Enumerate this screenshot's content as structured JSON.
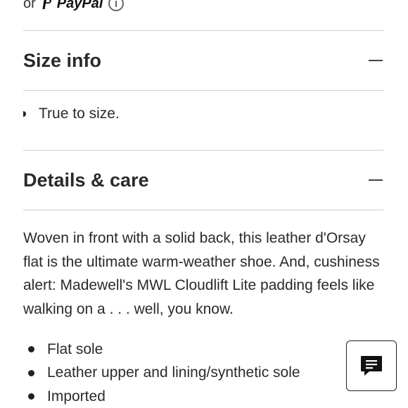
{
  "payment": {
    "or_text": "or",
    "paypal_text": "PayPal"
  },
  "sections": {
    "size_info": {
      "title": "Size info",
      "bullet": "True to size."
    },
    "details_care": {
      "title": "Details & care",
      "description": "Woven in front with a solid back, this leather d'Orsay flat is the ultimate warm-weather shoe. And, cushiness alert: Madewell's MWL Cloudlift Lite padding feels like walking on a . . . well, you know.",
      "bullets": [
        "Flat sole",
        "Leather upper and lining/synthetic sole",
        "Imported"
      ]
    }
  },
  "icons": {
    "collapse": "minus-icon",
    "info": "info-icon",
    "chat": "chat-icon",
    "paypal": "paypal-logo-icon"
  }
}
